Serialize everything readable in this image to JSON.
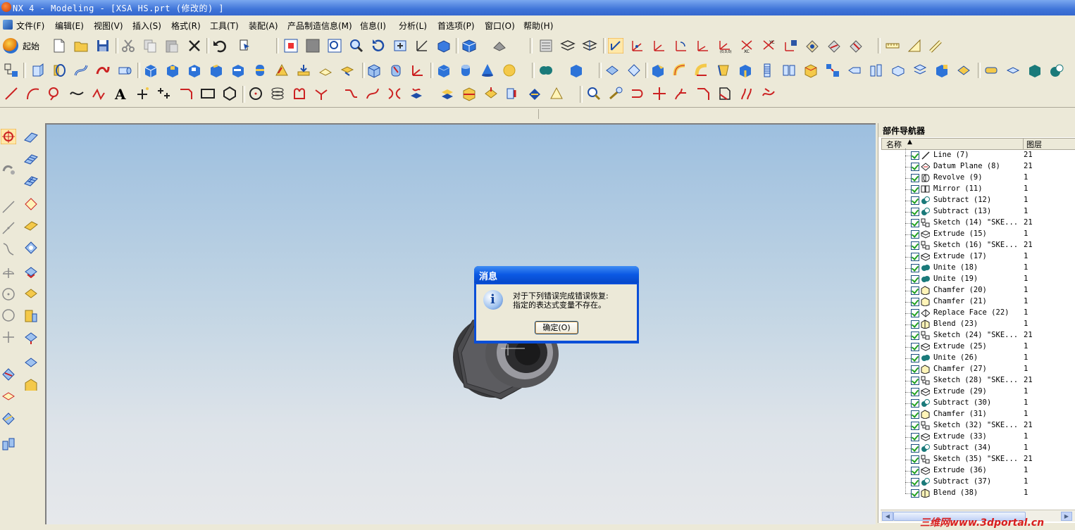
{
  "window": {
    "title": "NX 4 - Modeling - [XSA HS.prt  (修改的) ]"
  },
  "menu": {
    "items": [
      "文件(F)",
      "编辑(E)",
      "视图(V)",
      "插入(S)",
      "格式(R)",
      "工具(T)",
      "装配(A)",
      "产品制造信息(M)",
      "信息(I)",
      "分析(L)",
      "首选项(P)",
      "窗口(O)",
      "帮助(H)"
    ]
  },
  "toolbar": {
    "start_label": "起始"
  },
  "dialog": {
    "title": "消息",
    "line1": "对于下列错误完成错误恢复:",
    "line2": "指定的表达式变量不存在。",
    "ok_label": "确定(O)"
  },
  "navigator": {
    "title": "部件导航器",
    "col_name": "名称",
    "col_layer": "图层",
    "rows": [
      {
        "name": "Line (7)",
        "layer": "21",
        "icon": "line"
      },
      {
        "name": "Datum Plane (8)",
        "layer": "21",
        "icon": "datum"
      },
      {
        "name": "Revolve (9)",
        "layer": "1",
        "icon": "revolve"
      },
      {
        "name": "Mirror (11)",
        "layer": "1",
        "icon": "mirror"
      },
      {
        "name": "Subtract (12)",
        "layer": "1",
        "icon": "subtract"
      },
      {
        "name": "Subtract (13)",
        "layer": "1",
        "icon": "subtract"
      },
      {
        "name": "Sketch (14) \"SKE...",
        "layer": "21",
        "icon": "sketch"
      },
      {
        "name": "Extrude (15)",
        "layer": "1",
        "icon": "extrude"
      },
      {
        "name": "Sketch (16) \"SKE...",
        "layer": "21",
        "icon": "sketch"
      },
      {
        "name": "Extrude (17)",
        "layer": "1",
        "icon": "extrude"
      },
      {
        "name": "Unite (18)",
        "layer": "1",
        "icon": "unite"
      },
      {
        "name": "Unite (19)",
        "layer": "1",
        "icon": "unite"
      },
      {
        "name": "Chamfer (20)",
        "layer": "1",
        "icon": "chamfer"
      },
      {
        "name": "Chamfer (21)",
        "layer": "1",
        "icon": "chamfer"
      },
      {
        "name": "Replace Face (22)",
        "layer": "1",
        "icon": "replace"
      },
      {
        "name": "Blend (23)",
        "layer": "1",
        "icon": "blend"
      },
      {
        "name": "Sketch (24) \"SKE...",
        "layer": "21",
        "icon": "sketch"
      },
      {
        "name": "Extrude (25)",
        "layer": "1",
        "icon": "extrude"
      },
      {
        "name": "Unite (26)",
        "layer": "1",
        "icon": "unite"
      },
      {
        "name": "Chamfer (27)",
        "layer": "1",
        "icon": "chamfer"
      },
      {
        "name": "Sketch (28) \"SKE...",
        "layer": "21",
        "icon": "sketch"
      },
      {
        "name": "Extrude (29)",
        "layer": "1",
        "icon": "extrude"
      },
      {
        "name": "Subtract (30)",
        "layer": "1",
        "icon": "subtract"
      },
      {
        "name": "Chamfer (31)",
        "layer": "1",
        "icon": "chamfer"
      },
      {
        "name": "Sketch (32) \"SKE...",
        "layer": "21",
        "icon": "sketch"
      },
      {
        "name": "Extrude (33)",
        "layer": "1",
        "icon": "extrude"
      },
      {
        "name": "Subtract (34)",
        "layer": "1",
        "icon": "subtract"
      },
      {
        "name": "Sketch (35) \"SKE...",
        "layer": "21",
        "icon": "sketch"
      },
      {
        "name": "Extrude (36)",
        "layer": "1",
        "icon": "extrude"
      },
      {
        "name": "Subtract (37)",
        "layer": "1",
        "icon": "subtract"
      },
      {
        "name": "Blend (38)",
        "layer": "1",
        "icon": "blend"
      }
    ]
  },
  "watermark": {
    "text": "三维网www.3dportal.cn"
  },
  "colors": {
    "accent": "#0a4ed8",
    "title_bar": "#3f74d8",
    "check": "#21a121",
    "watermark": "#d81e1e"
  }
}
